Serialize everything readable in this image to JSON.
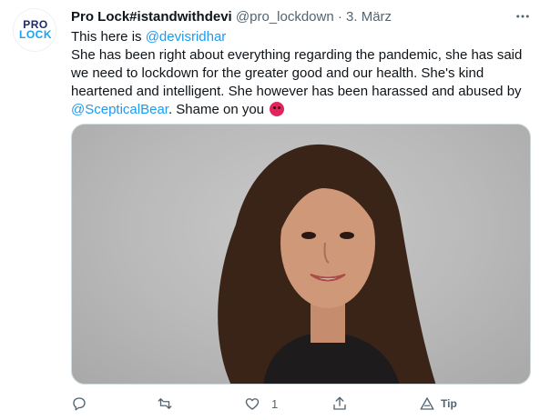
{
  "author": {
    "avatar_logo_top": "PRO",
    "avatar_logo_bottom": "LOCK",
    "name": "Pro Lock#istandwithdevi",
    "handle": "@pro_lockdown",
    "separator": "·",
    "date": "3. März"
  },
  "tweet": {
    "line1_text": "This here is ",
    "line1_mention": "@devisridhar",
    "body_text": "She has been right about everything regarding the pandemic, she has said we need to lockdown for the greater good and our health. She's kind heartened and intelligent. She however has been harassed and abused by ",
    "body_mention": "@ScepticalBear",
    "body_tail": ". Shame on you "
  },
  "actions": {
    "like_count": "1",
    "tip_label": "Tip"
  },
  "colors": {
    "accent": "#1d9bf0",
    "secondary_text": "#536471",
    "brand_dark": "#1b2a6b"
  }
}
